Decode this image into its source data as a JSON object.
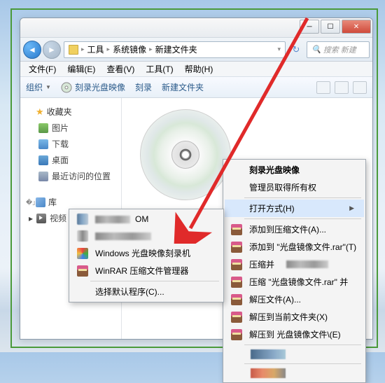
{
  "breadcrumb": {
    "seg1": "工具",
    "seg2": "系统镜像",
    "seg3": "新建文件夹"
  },
  "search_placeholder": "搜索 新建",
  "menubar": {
    "file": "文件(F)",
    "edit": "编辑(E)",
    "view": "查看(V)",
    "tools": "工具(T)",
    "help": "帮助(H)"
  },
  "toolbar": {
    "organize": "组织",
    "burn_image": "刻录光盘映像",
    "burn": "刻录",
    "new_folder": "新建文件夹"
  },
  "sidebar": {
    "favorites": "收藏夹",
    "fav_items": {
      "pictures": "图片",
      "downloads": "下载",
      "desktop": "桌面",
      "recent": "最近访问的位置"
    },
    "libraries": "库",
    "lib_items": {
      "videos": "视频"
    }
  },
  "ctx_main": {
    "burn_image": "刻录光盘映像",
    "admin_own": "管理员取得所有权",
    "open_with": "打开方式(H)",
    "add_archive": "添加到压缩文件(A)...",
    "add_rar": "添加到 \"光盘镜像文件.rar\"(T)",
    "compress_and": "压缩并",
    "compress_rar_and": "压缩 \"光盘镜像文件.rar\" 并",
    "extract": "解压文件(A)...",
    "extract_here": "解压到当前文件夹(X)",
    "extract_to": "解压到 光盘镜像文件\\(E)"
  },
  "ctx_sub": {
    "item_rom_suffix": "OM",
    "win_burner": "Windows 光盘映像刻录机",
    "winrar": "WinRAR 压缩文件管理器",
    "choose_default": "选择默认程序(C)..."
  }
}
